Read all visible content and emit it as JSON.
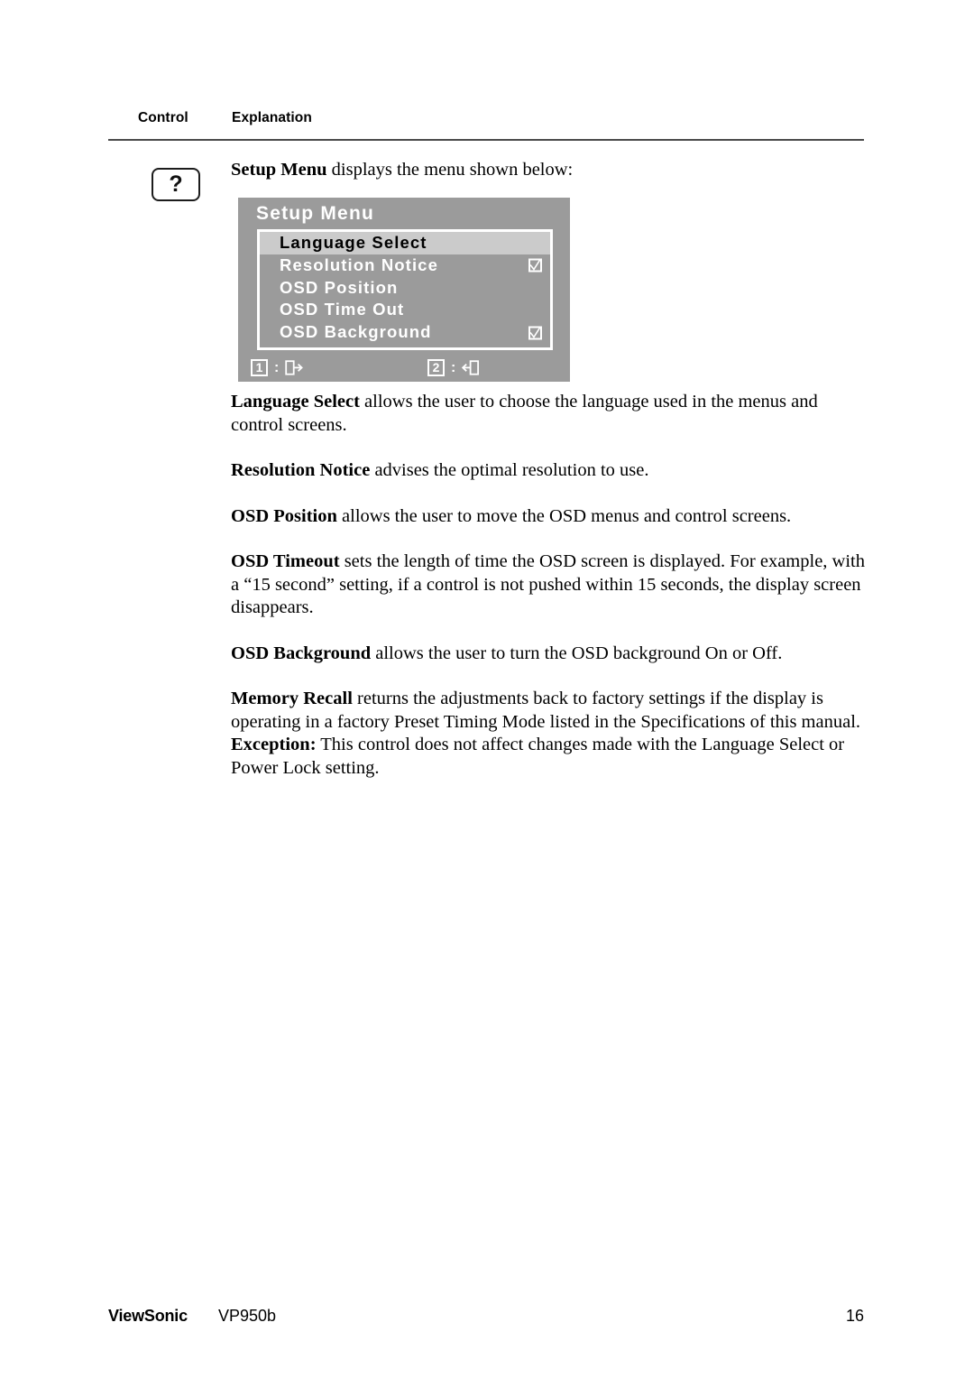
{
  "table_header": {
    "control": "Control",
    "explanation": "Explanation"
  },
  "control_icon": {
    "glyph": "?",
    "name": "question-mark-key"
  },
  "intro": {
    "bold": "Setup Menu",
    "rest": " displays the menu shown below:"
  },
  "osd": {
    "title": "Setup Menu",
    "rows": [
      {
        "label": "Language Select",
        "selected": true,
        "checkbox": false,
        "checked": false
      },
      {
        "label": "Resolution Notice",
        "selected": false,
        "checkbox": true,
        "checked": true
      },
      {
        "label": "OSD Position",
        "selected": false,
        "checkbox": false,
        "checked": false
      },
      {
        "label": "OSD Time Out",
        "selected": false,
        "checkbox": false,
        "checked": false
      },
      {
        "label": "OSD Background",
        "selected": false,
        "checkbox": true,
        "checked": true
      }
    ],
    "footer": {
      "key1": "1",
      "key1_separator": ":",
      "key1_icon": "exit-right-icon",
      "key2": "2",
      "key2_separator": ":",
      "key2_icon": "enter-left-icon"
    },
    "colors": {
      "background": "#9b9b9b",
      "selected_row": "#cbcbcb",
      "text": "#ffffff",
      "selected_text": "#000000"
    }
  },
  "paragraphs": [
    {
      "bold": "Language Select",
      "rest": " allows the user to choose the language used in the menus and control screens."
    },
    {
      "bold": "Resolution Notice",
      "rest": " advises the optimal resolution to use."
    },
    {
      "bold": "OSD Position",
      "rest": " allows the user to move the OSD menus and control screens."
    },
    {
      "bold": "OSD Timeout",
      "rest": " sets the length of time the OSD screen is displayed. For example, with a “15 second” setting, if a control is not pushed within 15 seconds, the display screen disappears."
    },
    {
      "bold": "OSD Background",
      "rest": " allows the user to turn the OSD background On or Off."
    },
    {
      "bold": "Memory Recall",
      "rest": " returns the adjustments back to factory settings if the display is operating in a factory Preset Timing Mode listed in the Specifications of this manual."
    },
    {
      "bold": "Exception:",
      "rest": " This control does not affect changes made with the Language Select or Power Lock setting."
    }
  ],
  "footer": {
    "brand": "ViewSonic",
    "model": "VP950b",
    "page": "16"
  }
}
